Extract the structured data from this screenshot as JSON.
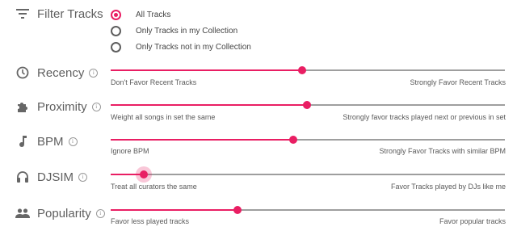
{
  "filter": {
    "title": "Filter Tracks",
    "options": [
      {
        "label": "All Tracks",
        "selected": true
      },
      {
        "label": "Only Tracks in my Collection",
        "selected": false
      },
      {
        "label": "Only Tracks not in my Collection",
        "selected": false
      }
    ]
  },
  "rows": [
    {
      "label": "Recency",
      "icon": "clock-icon",
      "value": 0.485,
      "min_label": "Don't Favor Recent Tracks",
      "max_label": "Strongly Favor Recent Tracks"
    },
    {
      "label": "Proximity",
      "icon": "puzzle-icon",
      "value": 0.498,
      "min_label": "Weight all songs in set the same",
      "max_label": "Strongly favor tracks played next or previous in set"
    },
    {
      "label": "BPM",
      "icon": "music-note-icon",
      "value": 0.463,
      "min_label": "Ignore BPM",
      "max_label": "Strongly Favor Tracks with similar BPM"
    },
    {
      "label": "DJSIM",
      "icon": "headphones-icon",
      "value": 0.084,
      "min_label": "Treat all curators the same",
      "max_label": "Favor Tracks played by DJs like me"
    },
    {
      "label": "Popularity",
      "icon": "people-icon",
      "value": 0.322,
      "min_label": "Favor less played tracks",
      "max_label": "Favor popular tracks"
    }
  ],
  "colors": {
    "accent": "#e91e63",
    "track": "#9e9e9e"
  }
}
